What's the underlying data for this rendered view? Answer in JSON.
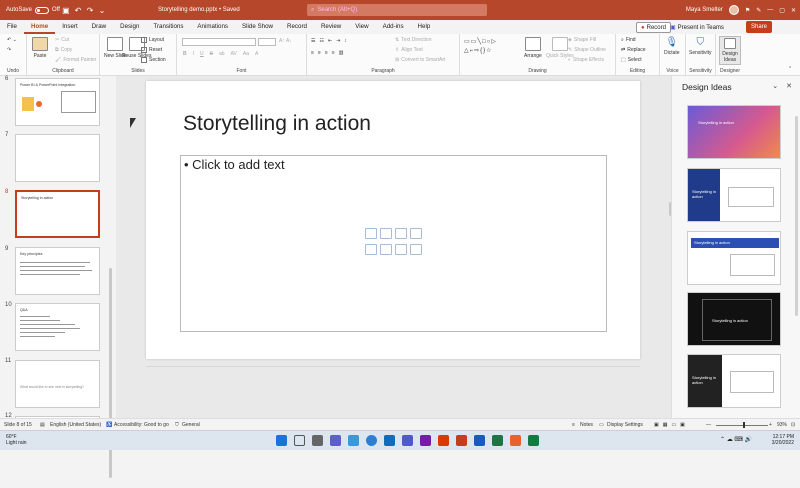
{
  "titlebar": {
    "autosave_label": "AutoSave",
    "autosave_state": "Off",
    "filename": "Storytelling demo.pptx • Saved",
    "search_placeholder": "Search (Alt+Q)",
    "user_name": "Maya Smelter"
  },
  "menu": {
    "items": [
      "File",
      "Home",
      "Insert",
      "Draw",
      "Design",
      "Transitions",
      "Animations",
      "Slide Show",
      "Record",
      "Review",
      "View",
      "Add-ins",
      "Help"
    ],
    "active": "Home",
    "record_label": "Record",
    "present_label": "Present in Teams",
    "share_label": "Share"
  },
  "ribbon": {
    "undo_group": "Undo",
    "clipboard": {
      "group": "Clipboard",
      "paste": "Paste",
      "cut": "Cut",
      "copy": "Copy",
      "format_painter": "Format Painter"
    },
    "slides": {
      "group": "Slides",
      "new_slide": "New Slide",
      "reuse": "Reuse Slides",
      "layout": "Layout",
      "reset": "Reset",
      "section": "Section"
    },
    "font": {
      "group": "Font",
      "bold": "B",
      "italic": "I",
      "underline": "U",
      "strike": "S"
    },
    "paragraph": {
      "group": "Paragraph",
      "text_direction": "Text Direction",
      "align_text": "Align Text",
      "convert": "Convert to SmartArt"
    },
    "drawing": {
      "group": "Drawing",
      "arrange": "Arrange",
      "quick_styles": "Quick Styles",
      "shape_fill": "Shape Fill",
      "shape_outline": "Shape Outline",
      "shape_effects": "Shape Effects"
    },
    "editing": {
      "group": "Editing",
      "find": "Find",
      "replace": "Replace",
      "select": "Select"
    },
    "voice": {
      "group": "Voice",
      "dictate": "Dictate"
    },
    "sensitivity": {
      "group": "Sensitivity",
      "label": "Sensitivity"
    },
    "designer": {
      "group": "Designer",
      "label": "Design Ideas"
    }
  },
  "thumbnails": [
    {
      "num": "6",
      "title": "Power BI & PowerPoint Integration",
      "selected": false
    },
    {
      "num": "7",
      "title": "",
      "selected": false
    },
    {
      "num": "8",
      "title": "Storytelling in action",
      "selected": true
    },
    {
      "num": "9",
      "title": "Key principles",
      "selected": false
    },
    {
      "num": "10",
      "title": "Q&A",
      "selected": false
    },
    {
      "num": "11",
      "title": "What would like to see next in storytelling?",
      "selected": false
    },
    {
      "num": "12",
      "title": "",
      "selected": false
    }
  ],
  "slide": {
    "title": "Storytelling in action",
    "content_placeholder": "• Click to add text"
  },
  "design_panel": {
    "title": "Design Ideas",
    "cards": [
      {
        "title": "Storytelling in action"
      },
      {
        "title": "Storytelling in action"
      },
      {
        "title": "Storytelling in action"
      },
      {
        "title": "Storytelling in action"
      },
      {
        "title": "Storytelling in action"
      }
    ]
  },
  "status": {
    "slide_info": "Slide 8 of 15",
    "language": "English (United States)",
    "accessibility": "Accessibility: Good to go",
    "sensitivity": "General",
    "notes": "Notes",
    "display": "Display Settings",
    "zoom": "93%"
  },
  "taskbar": {
    "temp": "60°F",
    "weather": "Light rain",
    "time": "12:17 PM",
    "date": "3/20/2022"
  }
}
